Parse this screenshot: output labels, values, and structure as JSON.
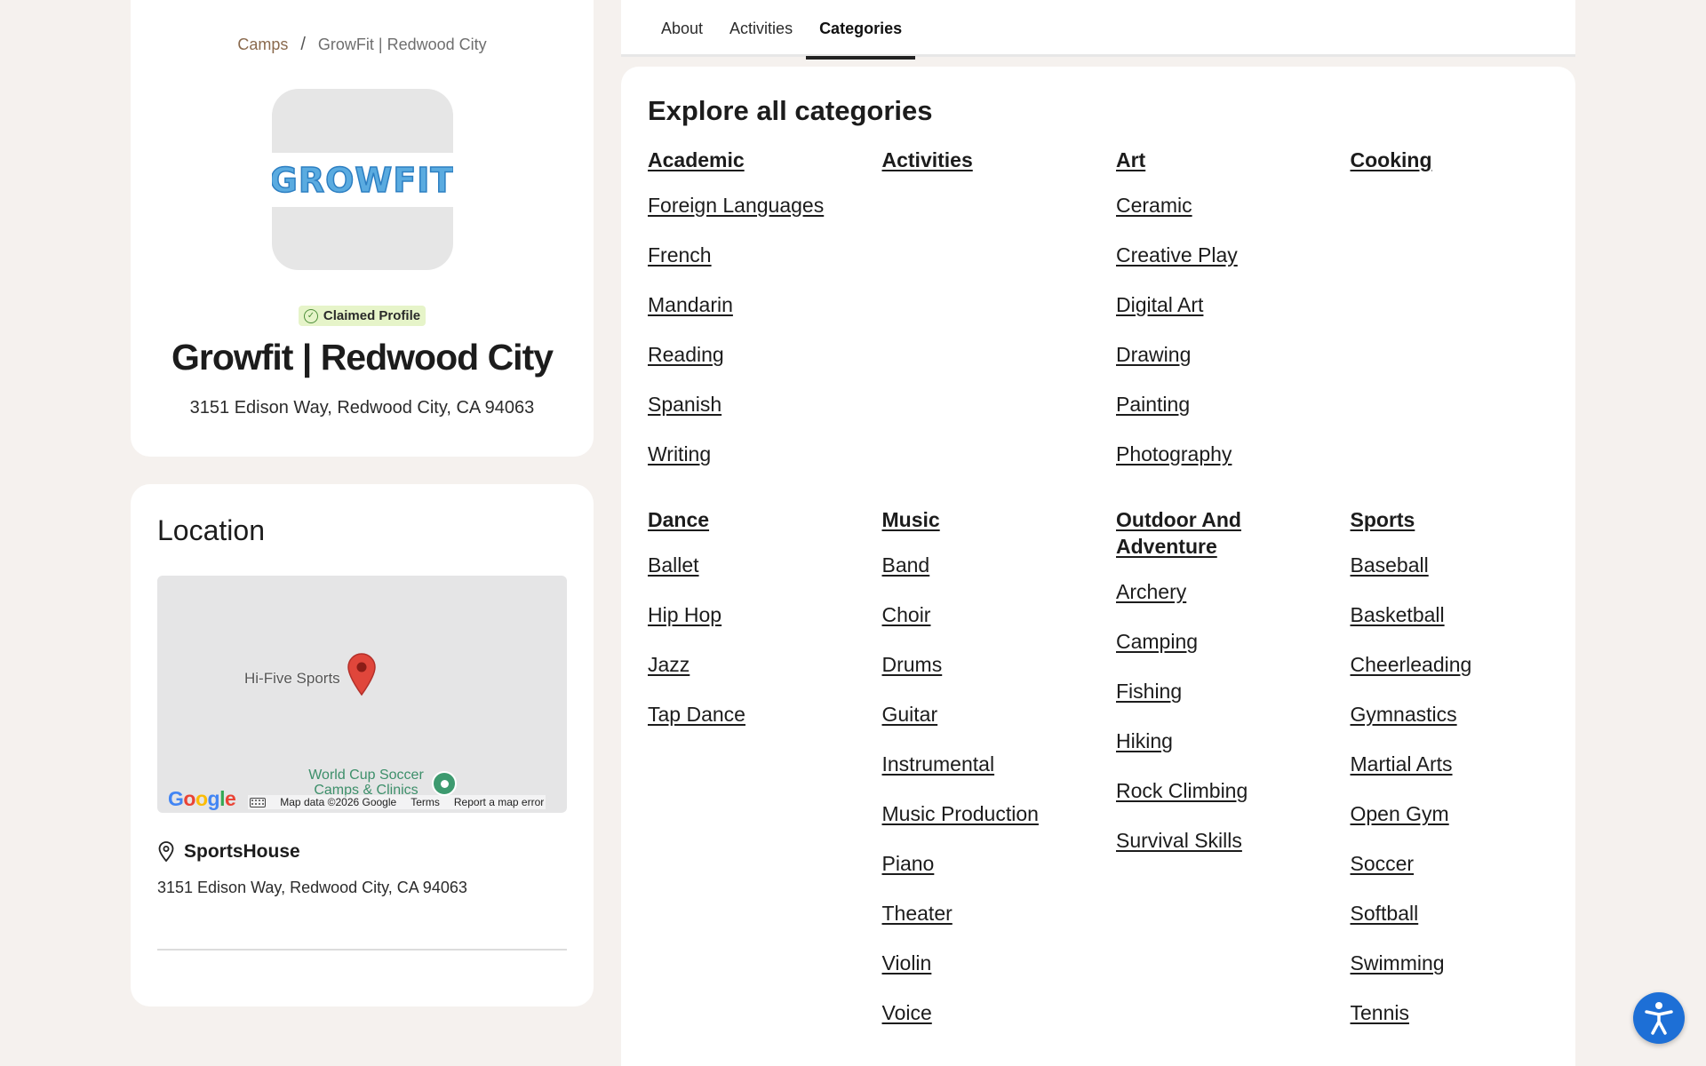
{
  "breadcrumb": {
    "root": "Camps",
    "separator": "/",
    "current": "GrowFit | Redwood City"
  },
  "profile": {
    "logo_text": "GROWFIT",
    "badge": "Claimed Profile",
    "name": "Growfit | Redwood City",
    "address": "3151 Edison Way, Redwood City, CA 94063"
  },
  "location": {
    "title": "Location",
    "map": {
      "place_label": "Hi-Five Sports",
      "poi_line1": "World Cup Soccer",
      "poi_line2": "Camps & Clinics",
      "attribution": "Map data ©2026 Google",
      "terms": "Terms",
      "report": "Report a map error"
    },
    "venue_name": "SportsHouse",
    "venue_address": "3151 Edison Way, Redwood City, CA 94063"
  },
  "tabs": [
    {
      "label": "About",
      "active": false
    },
    {
      "label": "Activities",
      "active": false
    },
    {
      "label": "Categories",
      "active": true
    }
  ],
  "categories": {
    "title": "Explore all categories",
    "groups": [
      {
        "heading": "Academic",
        "items": [
          "Foreign Languages",
          "French",
          "Mandarin",
          "Reading",
          "Spanish",
          "Writing"
        ]
      },
      {
        "heading": "Activities",
        "items": []
      },
      {
        "heading": "Art",
        "items": [
          "Ceramic",
          "Creative Play",
          "Digital Art",
          "Drawing",
          "Painting",
          "Photography"
        ]
      },
      {
        "heading": "Cooking",
        "items": []
      },
      {
        "heading": "Dance",
        "items": [
          "Ballet",
          "Hip Hop",
          "Jazz",
          "Tap Dance"
        ]
      },
      {
        "heading": "Music",
        "items": [
          "Band",
          "Choir",
          "Drums",
          "Guitar",
          "Instrumental",
          "Music Production",
          "Piano",
          "Theater",
          "Violin",
          "Voice"
        ]
      },
      {
        "heading": "Outdoor And Adventure",
        "items": [
          "Archery",
          "Camping",
          "Fishing",
          "Hiking",
          "Rock Climbing",
          "Survival Skills"
        ]
      },
      {
        "heading": "Sports",
        "items": [
          "Baseball",
          "Basketball",
          "Cheerleading",
          "Gymnastics",
          "Martial Arts",
          "Open Gym",
          "Soccer",
          "Softball",
          "Swimming",
          "Tennis"
        ]
      }
    ]
  },
  "colors": {
    "page_background": "#f5f1ee",
    "breadcrumb_link": "#8a6a4e",
    "badge_background": "#e6f4c9",
    "logo_blue": "#5aabe0",
    "a11y_button": "#1d6fd6",
    "map_pin": "#e0463b"
  }
}
